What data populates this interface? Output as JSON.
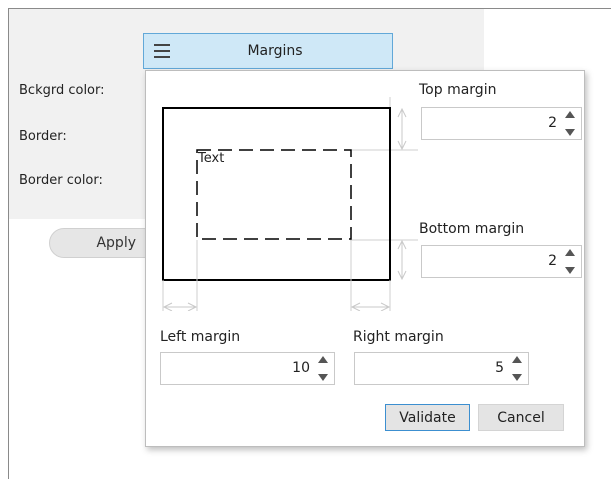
{
  "background_form": {
    "labels": {
      "bckgrd_color": "Bckgrd color:",
      "border": "Border:",
      "border_color": "Border color:"
    },
    "apply_label": "Apply"
  },
  "margins_button": {
    "label": "Margins",
    "icon": "hamburger-menu-icon"
  },
  "popup": {
    "preview_text": "Text",
    "top_margin": {
      "label": "Top margin",
      "value": "2"
    },
    "bottom_margin": {
      "label": "Bottom margin",
      "value": "2"
    },
    "left_margin": {
      "label": "Left margin",
      "value": "10"
    },
    "right_margin": {
      "label": "Right margin",
      "value": "5"
    },
    "validate_label": "Validate",
    "cancel_label": "Cancel"
  },
  "colors": {
    "accent": "#62a8d8",
    "menu_button_bg": "#cfe8f7",
    "validate_border": "#3c8fd0"
  }
}
